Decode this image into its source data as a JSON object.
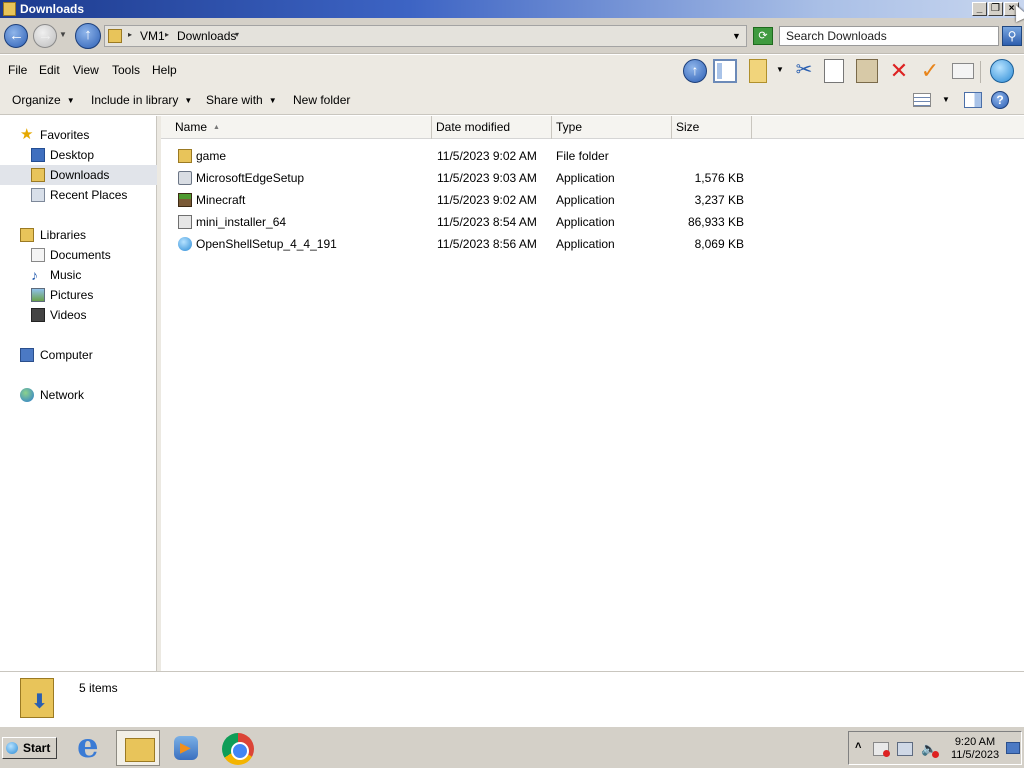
{
  "window": {
    "title": "Downloads"
  },
  "address": {
    "crumbs": [
      "VM1",
      "Downloads"
    ],
    "search_placeholder": "Search Downloads"
  },
  "menu": {
    "items": [
      "File",
      "Edit",
      "View",
      "Tools",
      "Help"
    ]
  },
  "commands": {
    "organize": "Organize",
    "include_in_library": "Include in library",
    "share_with": "Share with",
    "new_folder": "New folder"
  },
  "nav": {
    "favorites": {
      "label": "Favorites",
      "items": [
        "Desktop",
        "Downloads",
        "Recent Places"
      ]
    },
    "libraries": {
      "label": "Libraries",
      "items": [
        "Documents",
        "Music",
        "Pictures",
        "Videos"
      ]
    },
    "computer": "Computer",
    "network": "Network",
    "selected": "Downloads"
  },
  "columns": {
    "name": "Name",
    "date": "Date modified",
    "type": "Type",
    "size": "Size"
  },
  "files": [
    {
      "name": "game",
      "date": "11/5/2023 9:02 AM",
      "type": "File folder",
      "size": "",
      "icon": "folder-icon"
    },
    {
      "name": "MicrosoftEdgeSetup",
      "date": "11/5/2023 9:03 AM",
      "type": "Application",
      "size": "1,576 KB",
      "icon": "installer-icon"
    },
    {
      "name": "Minecraft",
      "date": "11/5/2023 9:02 AM",
      "type": "Application",
      "size": "3,237 KB",
      "icon": "minecraft-icon"
    },
    {
      "name": "mini_installer_64",
      "date": "11/5/2023 8:54 AM",
      "type": "Application",
      "size": "86,933 KB",
      "icon": "setup-icon"
    },
    {
      "name": "OpenShellSetup_4_4_191",
      "date": "11/5/2023 8:56 AM",
      "type": "Application",
      "size": "8,069 KB",
      "icon": "shell-icon"
    }
  ],
  "details": {
    "count": "5 items"
  },
  "taskbar": {
    "start": "Start",
    "clock_time": "9:20 AM",
    "clock_date": "11/5/2023"
  }
}
